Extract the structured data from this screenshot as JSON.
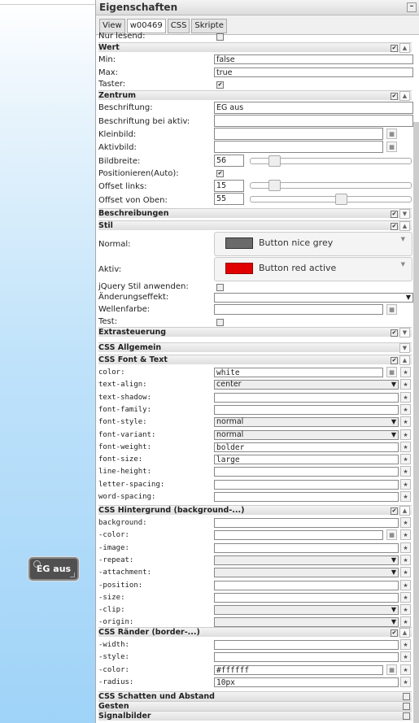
{
  "canvas": {
    "button_label": "EG aus"
  },
  "panel": {
    "title": "Eigenschaften",
    "tabs": [
      "View",
      "w00469",
      "CSS",
      "Skripte"
    ],
    "nur_lesend": "Nur lesend:",
    "wert": {
      "title": "Wert",
      "min_label": "Min:",
      "min_value": "false",
      "max_label": "Max:",
      "max_value": "true",
      "taster_label": "Taster:"
    },
    "zentrum": {
      "title": "Zentrum",
      "beschriftung_label": "Beschriftung:",
      "beschriftung_value": "EG aus",
      "beschriftung_aktiv_label": "Beschriftung bei aktiv:",
      "kleinbild_label": "Kleinbild:",
      "aktivbild_label": "Aktivbild:",
      "bildbreite_label": "Bildbreite:",
      "bildbreite_value": "56",
      "positionieren_label": "Positionieren(Auto):",
      "offset_links_label": "Offset links:",
      "offset_links_value": "15",
      "offset_oben_label": "Offset von Oben:",
      "offset_oben_value": "55"
    },
    "beschreibungen": {
      "title": "Beschreibungen"
    },
    "stil": {
      "title": "Stil",
      "normal_label": "Normal:",
      "normal_style": "Button nice grey",
      "normal_color": "#6a6a6a",
      "aktiv_label": "Aktiv:",
      "aktiv_style": "Button red active",
      "aktiv_color": "#e00000",
      "jquery_label": "jQuery Stil anwenden:",
      "aenderung_label": "Änderungseffekt:",
      "wellenfarbe_label": "Wellenfarbe:",
      "test_label": "Test:"
    },
    "extrasteuerung": {
      "title": "Extrasteuerung"
    },
    "css_allgemein": {
      "title": "CSS Allgemein"
    },
    "css_font": {
      "title": "CSS Font & Text",
      "rows": [
        {
          "label": "color:",
          "value": "white",
          "kind": "input",
          "btn": true
        },
        {
          "label": "text-align:",
          "value": "center",
          "kind": "select"
        },
        {
          "label": "text-shadow:",
          "value": "",
          "kind": "input"
        },
        {
          "label": "font-family:",
          "value": "",
          "kind": "input"
        },
        {
          "label": "font-style:",
          "value": "normal",
          "kind": "select"
        },
        {
          "label": "font-variant:",
          "value": "normal",
          "kind": "select"
        },
        {
          "label": "font-weight:",
          "value": "bolder",
          "kind": "input"
        },
        {
          "label": "font-size:",
          "value": "large",
          "kind": "input"
        },
        {
          "label": "line-height:",
          "value": "",
          "kind": "input"
        },
        {
          "label": "letter-spacing:",
          "value": "",
          "kind": "input"
        },
        {
          "label": "word-spacing:",
          "value": "",
          "kind": "input"
        }
      ]
    },
    "css_hintergrund": {
      "title": "CSS Hintergrund (background-...)",
      "rows": [
        {
          "label": "background:",
          "value": "",
          "kind": "input"
        },
        {
          "label": "-color:",
          "value": "",
          "kind": "input",
          "btn": true
        },
        {
          "label": "-image:",
          "value": "",
          "kind": "input"
        },
        {
          "label": "-repeat:",
          "value": "",
          "kind": "select"
        },
        {
          "label": "-attachment:",
          "value": "",
          "kind": "select"
        },
        {
          "label": "-position:",
          "value": "",
          "kind": "input"
        },
        {
          "label": "-size:",
          "value": "",
          "kind": "input"
        },
        {
          "label": "-clip:",
          "value": "",
          "kind": "select"
        },
        {
          "label": "-origin:",
          "value": "",
          "kind": "select"
        }
      ]
    },
    "css_raender": {
      "title": "CSS Ränder (border-...)",
      "rows": [
        {
          "label": "-width:",
          "value": "",
          "kind": "input"
        },
        {
          "label": "-style:",
          "value": "",
          "kind": "input"
        },
        {
          "label": "-color:",
          "value": "#ffffff",
          "kind": "input",
          "btn": true
        },
        {
          "label": "-radius:",
          "value": "10px",
          "kind": "input"
        }
      ]
    },
    "css_schatten": {
      "title": "CSS Schatten und Abstand"
    },
    "gesten": {
      "title": "Gesten"
    },
    "signalbilder": {
      "title": "Signalbilder"
    }
  }
}
